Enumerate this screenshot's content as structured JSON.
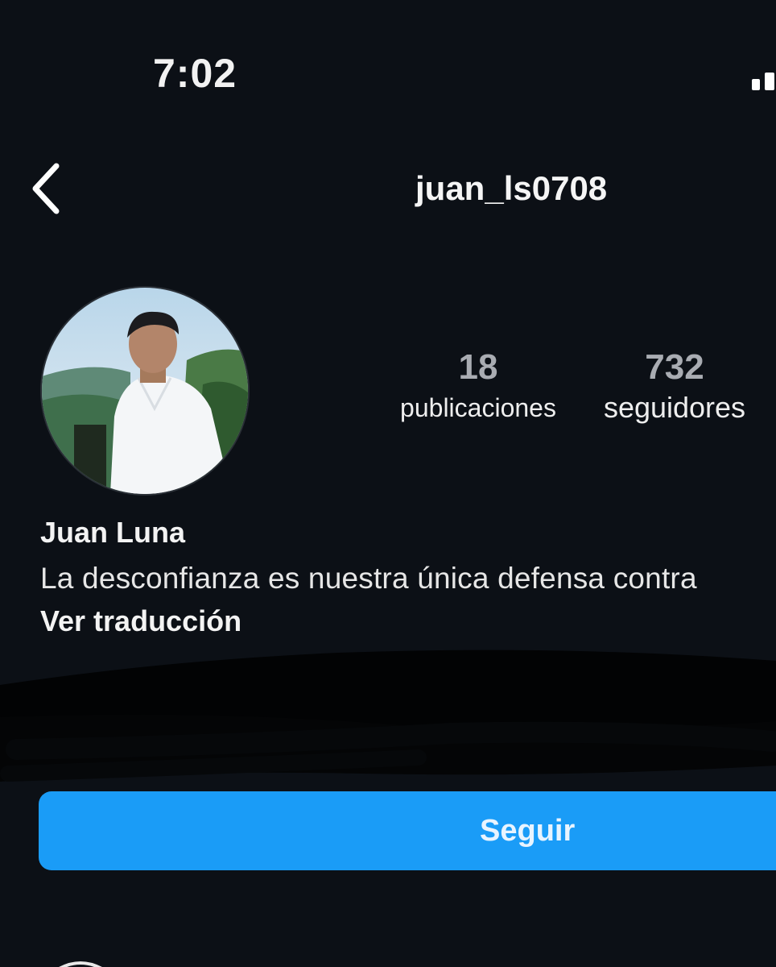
{
  "status_bar": {
    "time": "7:02"
  },
  "header": {
    "back_icon": "chevron-left-icon",
    "username": "juan_ls0708"
  },
  "profile": {
    "avatar_description_icon": "profile-photo",
    "stats": [
      {
        "count": "18",
        "label": "publicaciones"
      },
      {
        "count": "732",
        "label": "seguidores"
      }
    ],
    "display_name": "Juan Luna",
    "bio": "La desconfianza es nuestra única defensa contra",
    "translate_label": "Ver traducción"
  },
  "actions": {
    "follow_label": "Seguir"
  },
  "colors": {
    "background": "#0c1016",
    "accent": "#1a9cf7"
  }
}
